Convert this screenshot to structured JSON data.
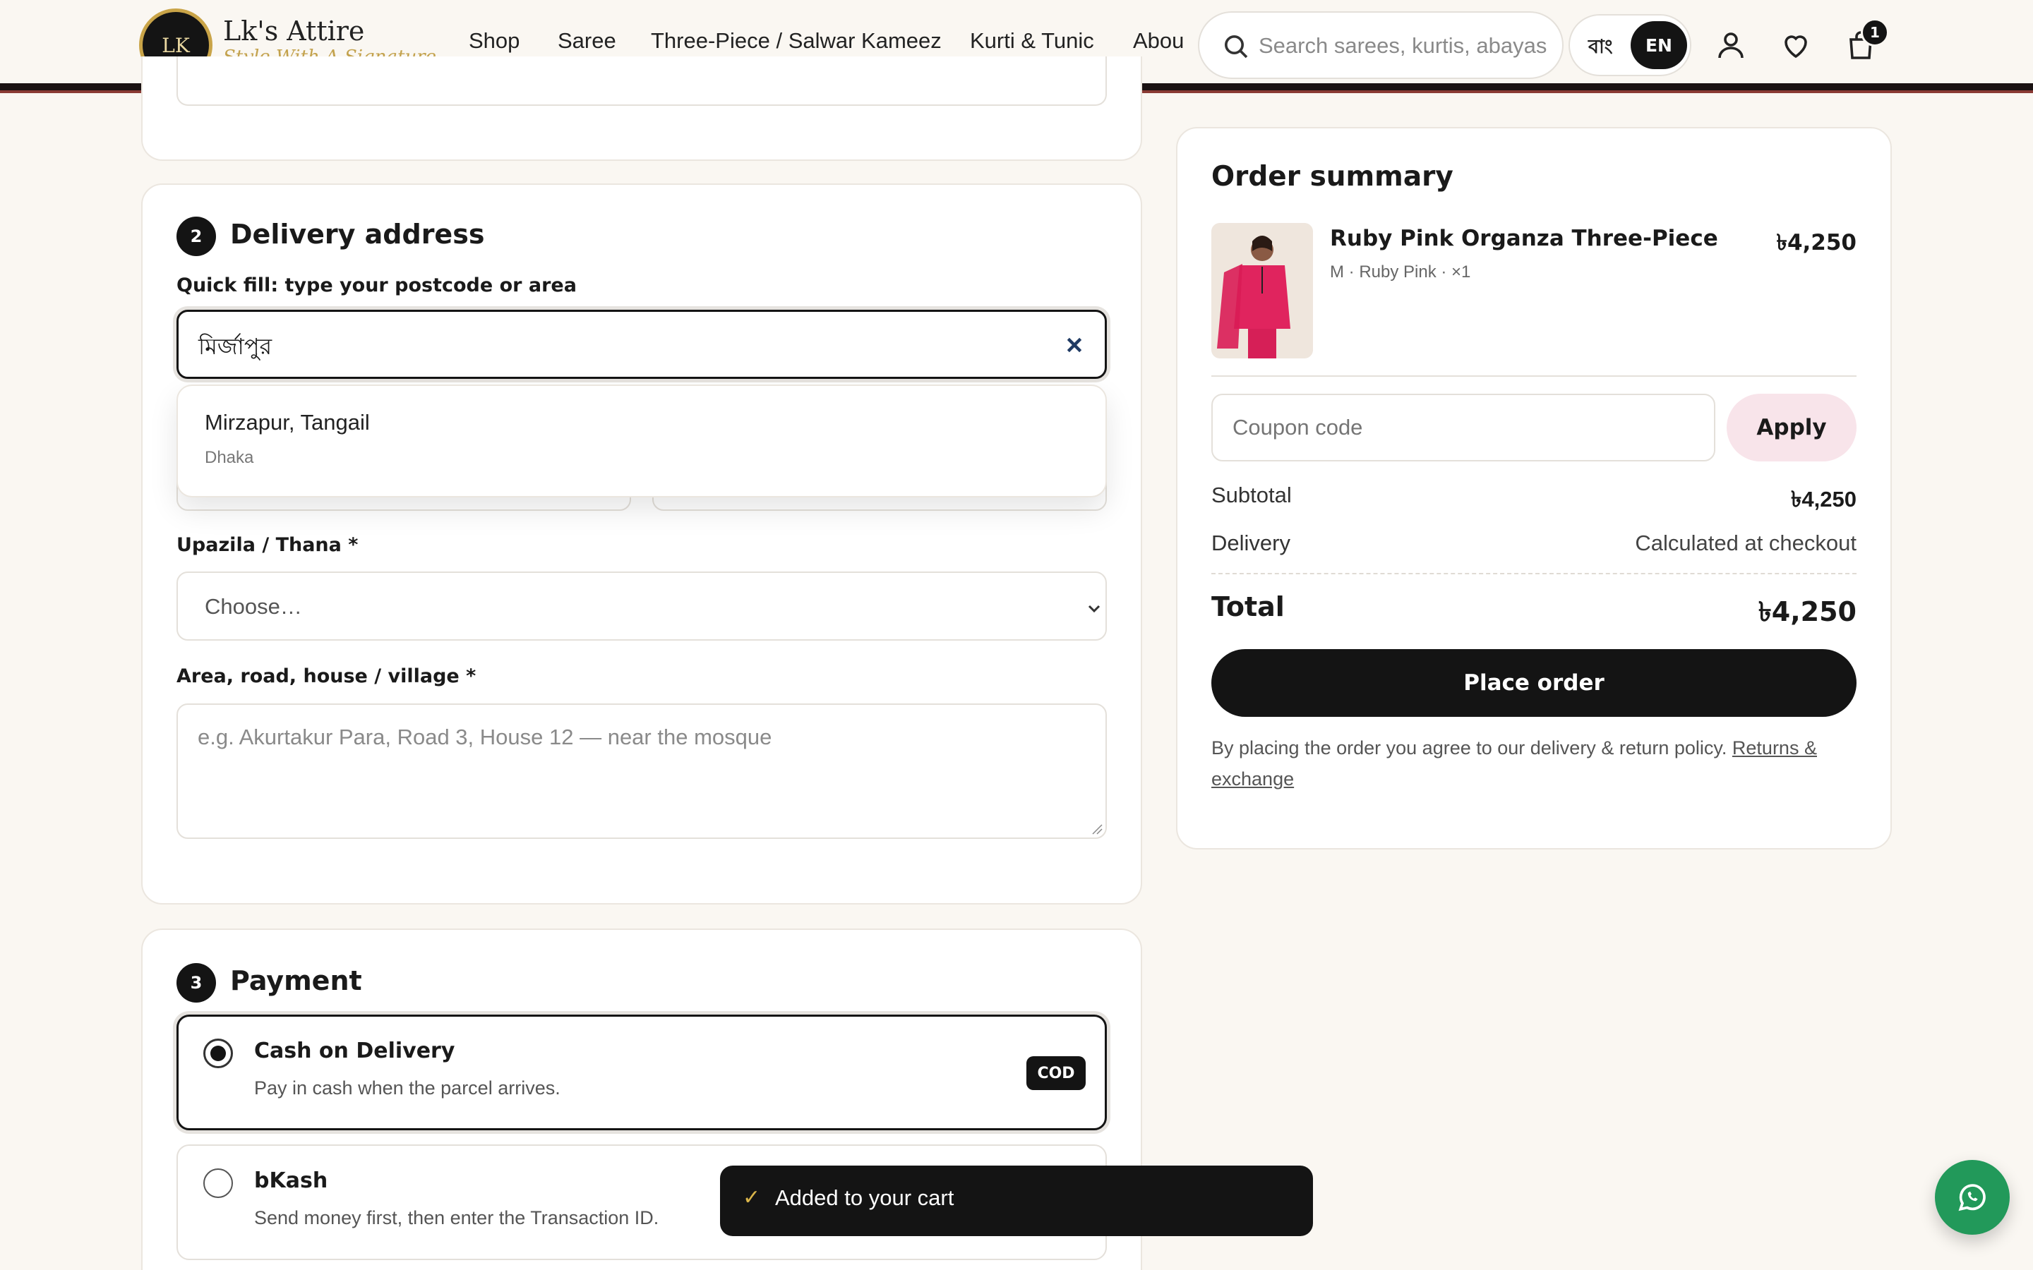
{
  "header": {
    "logo_initials": "LK",
    "logo_title": "Lk's Attire",
    "logo_tagline": "Style With A Signature",
    "nav": [
      "Shop",
      "Saree",
      "Three-Piece / Salwar Kameez",
      "Kurti & Tunic",
      "Abou"
    ],
    "search_placeholder": "Search sarees, kurtis, abayas",
    "lang_bn": "বাং",
    "lang_en": "EN",
    "cart_count": "1"
  },
  "delivery": {
    "step": "2",
    "title": "Delivery address",
    "quick_fill_label": "Quick fill: type your postcode or area",
    "quick_fill_value": "মির্জাপুর",
    "suggestion": {
      "name": "Mirzapur, Tangail",
      "division": "Dhaka"
    },
    "upazila_label": "Upazila / Thana *",
    "upazila_value": "Choose…",
    "address_label": "Area, road, house / village *",
    "address_placeholder": "e.g. Akurtakur Para, Road 3, House 12 — near the mosque"
  },
  "payment": {
    "step": "3",
    "title": "Payment",
    "options": [
      {
        "title": "Cash on Delivery",
        "desc": "Pay in cash when the parcel arrives.",
        "badge": "COD",
        "selected": true
      },
      {
        "title": "bKash",
        "desc": "Send money first, then enter the Transaction ID.",
        "selected": false
      }
    ]
  },
  "summary": {
    "title": "Order summary",
    "item": {
      "name": "Ruby Pink Organza Three-Piece",
      "meta": "M · Ruby Pink · ×1",
      "price": "৳4,250"
    },
    "coupon_placeholder": "Coupon code",
    "apply_label": "Apply",
    "subtotal_label": "Subtotal",
    "subtotal_value": "৳4,250",
    "delivery_label": "Delivery",
    "delivery_value": "Calculated at checkout",
    "total_label": "Total",
    "total_value": "৳4,250",
    "place_order": "Place order",
    "policy_text": "By placing the order you agree to our delivery & return policy.",
    "policy_link_1": "Returns &",
    "policy_link_2": "exchange"
  },
  "toast": {
    "check": "✓",
    "message": "Added to your cart"
  },
  "colors": {
    "accent": "#141414",
    "page_bg": "#faf7f2",
    "gold": "#c9a448",
    "apply_bg": "#f8e4ea",
    "whatsapp": "#22995a"
  }
}
